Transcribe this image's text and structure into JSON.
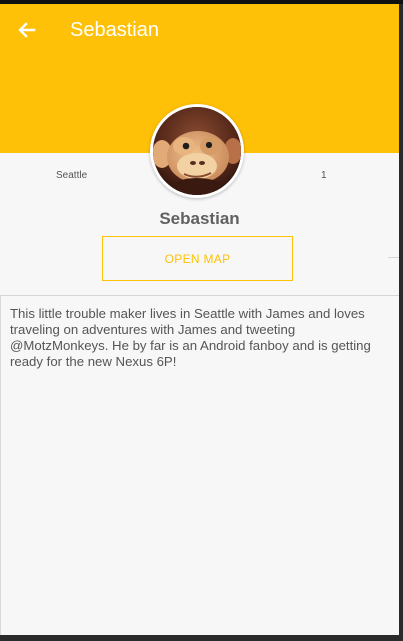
{
  "toolbar": {
    "back_icon": "arrow-left-icon",
    "title": "Sebastian"
  },
  "profile": {
    "location": "Seattle",
    "count": "1",
    "avatar": "monkey-avatar",
    "name": "Sebastian",
    "map_button_label": "OPEN MAP",
    "description": "This little trouble maker lives in Seattle with James and loves traveling on adventures with James and tweeting @MotzMonkeys. He by far is an Android fanboy and is getting ready for the new Nexus 6P!"
  },
  "theme": {
    "accent": "#ffc107",
    "background": "#f7f7f7",
    "text": "#555555",
    "name_text": "#616161"
  }
}
